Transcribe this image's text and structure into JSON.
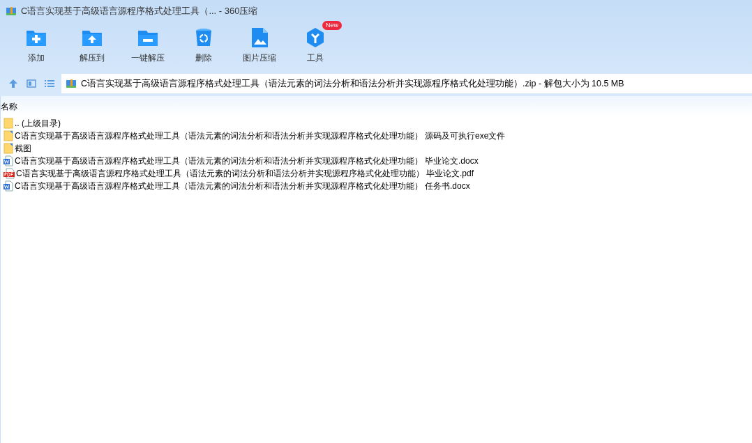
{
  "window": {
    "title": "C语言实现基于高级语言源程序格式处理工具（... - 360压缩"
  },
  "toolbar": [
    {
      "kind": "add",
      "label": "添加"
    },
    {
      "kind": "extract-to",
      "label": "解压到"
    },
    {
      "kind": "extract",
      "label": "一键解压"
    },
    {
      "kind": "delete",
      "label": "删除"
    },
    {
      "kind": "image",
      "label": "图片压缩"
    },
    {
      "kind": "tools",
      "label": "工具",
      "badge": "New"
    }
  ],
  "address": {
    "value": "C语言实现基于高级语言源程序格式处理工具（语法元素的词法分析和语法分析并实现源程序格式化处理功能）.zip - 解包大小为 10.5 MB"
  },
  "table": {
    "columns": [
      "名称"
    ],
    "rows": [
      {
        "kind": "up",
        "name": ".. (上级目录)"
      },
      {
        "kind": "folder",
        "name": "C语言实现基于高级语言源程序格式处理工具（语法元素的词法分析和语法分析并实现源程序格式化处理功能） 源码及可执行exe文件"
      },
      {
        "kind": "folder",
        "name": "截图"
      },
      {
        "kind": "word",
        "name": "C语言实现基于高级语言源程序格式处理工具（语法元素的词法分析和语法分析并实现源程序格式化处理功能） 毕业论文.docx"
      },
      {
        "kind": "pdf",
        "name": "C语言实现基于高级语言源程序格式处理工具（语法元素的词法分析和语法分析并实现源程序格式化处理功能） 毕业论文.pdf"
      },
      {
        "kind": "word",
        "name": "C语言实现基于高级语言源程序格式处理工具（语法元素的词法分析和语法分析并实现源程序格式化处理功能） 任务书.docx"
      }
    ]
  }
}
